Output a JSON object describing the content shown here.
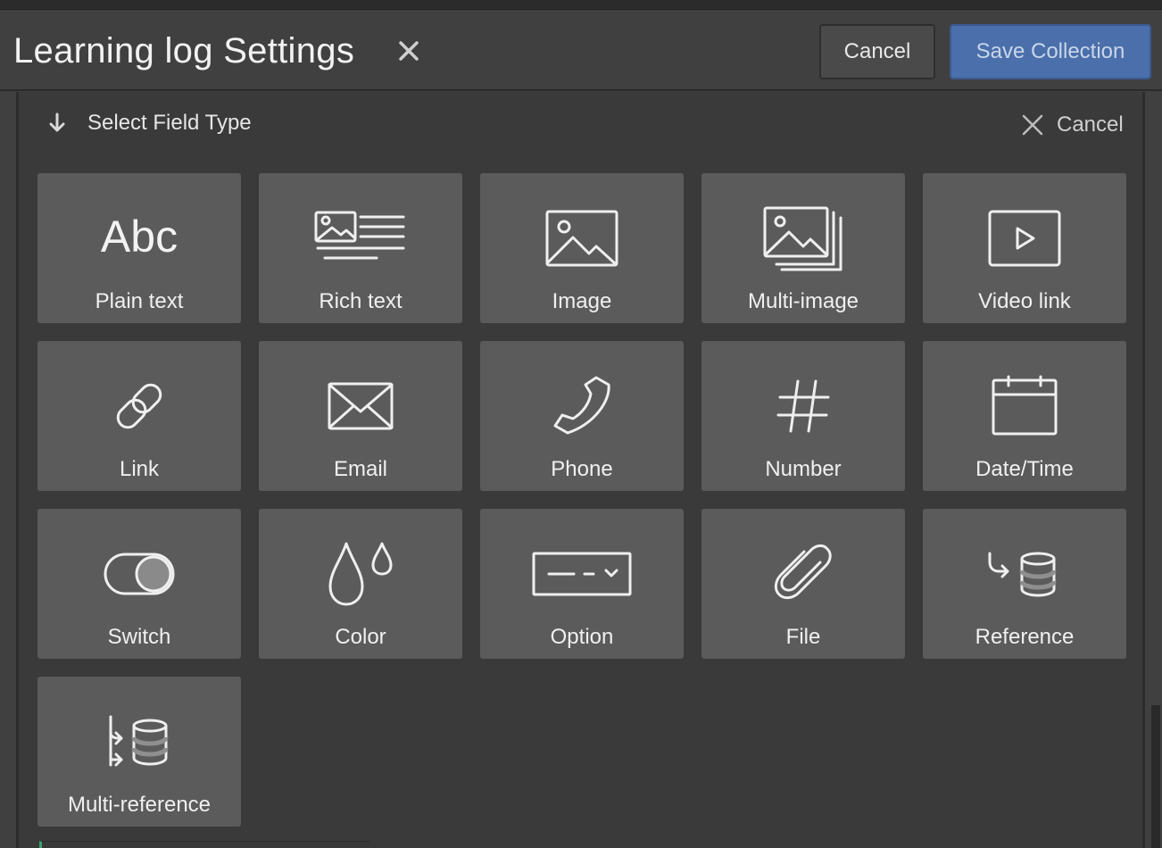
{
  "header": {
    "title": "Learning log Settings",
    "cancel_label": "Cancel",
    "save_label": "Save Collection"
  },
  "section": {
    "title": "Select Field Type",
    "cancel_label": "Cancel"
  },
  "field_types": [
    {
      "label": "Plain text",
      "icon": "text-abc-icon"
    },
    {
      "label": "Rich text",
      "icon": "rich-text-icon"
    },
    {
      "label": "Image",
      "icon": "image-icon"
    },
    {
      "label": "Multi-image",
      "icon": "multi-image-icon"
    },
    {
      "label": "Video link",
      "icon": "video-play-icon"
    },
    {
      "label": "Link",
      "icon": "link-icon"
    },
    {
      "label": "Email",
      "icon": "envelope-icon"
    },
    {
      "label": "Phone",
      "icon": "phone-icon"
    },
    {
      "label": "Number",
      "icon": "hash-icon"
    },
    {
      "label": "Date/Time",
      "icon": "calendar-icon"
    },
    {
      "label": "Switch",
      "icon": "toggle-icon"
    },
    {
      "label": "Color",
      "icon": "droplets-icon"
    },
    {
      "label": "Option",
      "icon": "dropdown-icon"
    },
    {
      "label": "File",
      "icon": "paperclip-icon"
    },
    {
      "label": "Reference",
      "icon": "reference-icon"
    },
    {
      "label": "Multi-reference",
      "icon": "multi-reference-icon"
    }
  ],
  "colors": {
    "background": "#404040",
    "tile": "#5b5b5b",
    "save_button": "#4a6faa"
  }
}
